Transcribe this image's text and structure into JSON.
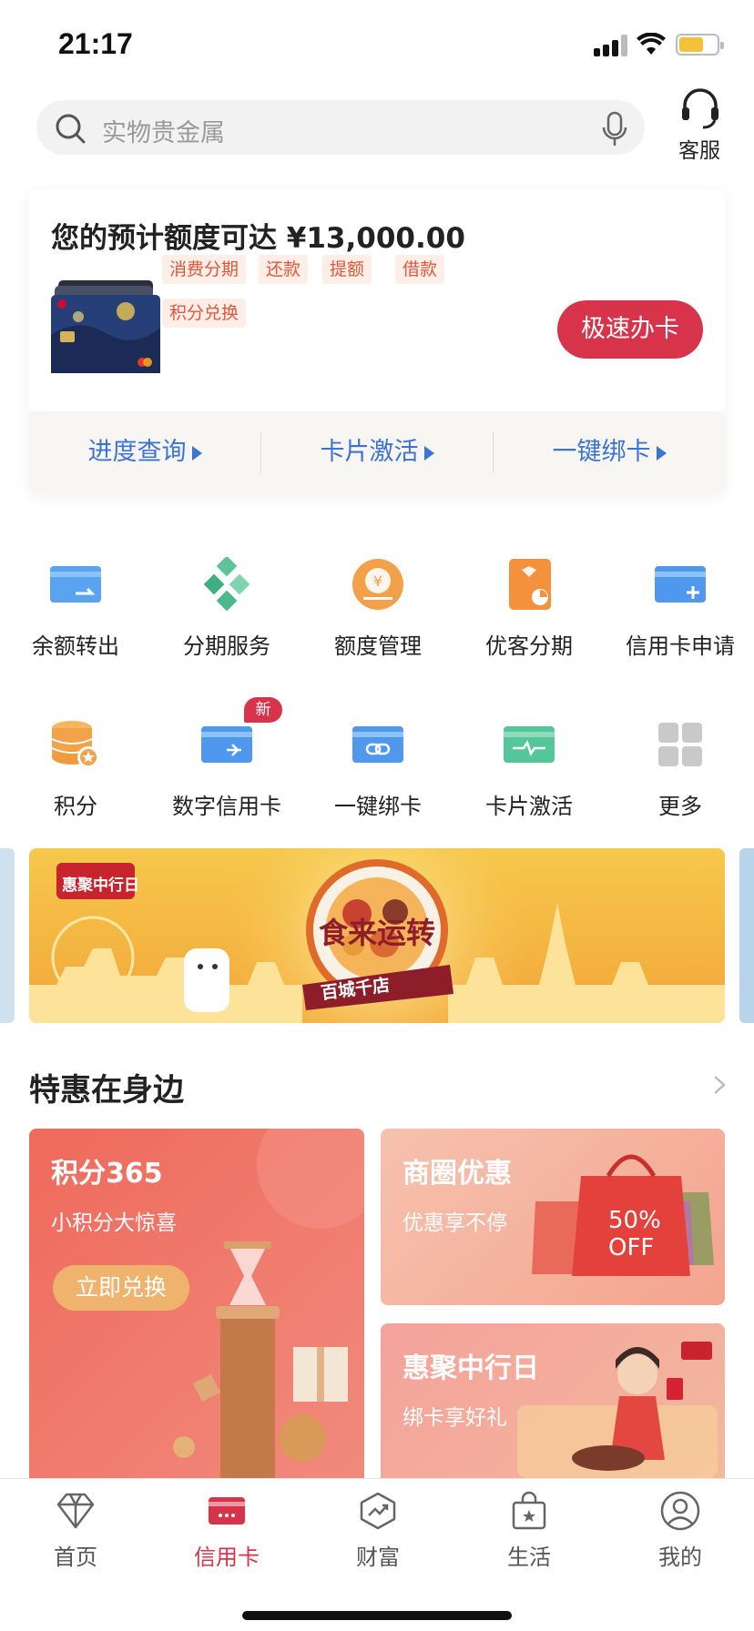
{
  "status_bar": {
    "time": "21:17"
  },
  "search": {
    "placeholder": "实物贵金属"
  },
  "header": {
    "service_label": "客服"
  },
  "credit_card_panel": {
    "title": "您的预计额度可达 ¥13,000.00",
    "tags": [
      "消费分期",
      "还款",
      "提额",
      "借款",
      "积分兑换"
    ],
    "apply_button": "极速办卡",
    "links": [
      "进度查询",
      "卡片激活",
      "一键绑卡"
    ]
  },
  "grid": {
    "row1": [
      {
        "label": "余额转出",
        "icon": "balance-transfer-icon"
      },
      {
        "label": "分期服务",
        "icon": "installment-service-icon"
      },
      {
        "label": "额度管理",
        "icon": "limit-management-icon"
      },
      {
        "label": "优客分期",
        "icon": "youke-installment-icon"
      },
      {
        "label": "信用卡申请",
        "icon": "card-apply-icon"
      }
    ],
    "row2": [
      {
        "label": "积分",
        "icon": "points-icon"
      },
      {
        "label": "数字信用卡",
        "icon": "digital-card-icon"
      },
      {
        "label": "一键绑卡",
        "icon": "bind-card-icon"
      },
      {
        "label": "卡片激活",
        "icon": "card-activate-icon"
      },
      {
        "label": "更多",
        "icon": "more-grid-icon"
      }
    ],
    "new_badge": "新"
  },
  "banner": {
    "logo_text": "惠聚中行日",
    "center_text": "食来运转",
    "sub_text": "百城千店"
  },
  "section": {
    "title": "特惠在身边"
  },
  "promos": {
    "points": {
      "title": "积分365",
      "subtitle": "小积分大惊喜",
      "button": "立即兑换"
    },
    "mall": {
      "title": "商圈优惠",
      "subtitle": "优惠享不停",
      "sale_text_1": "50%",
      "sale_text_2": "OFF"
    },
    "boc_day": {
      "title": "惠聚中行日",
      "subtitle": "绑卡享好礼"
    }
  },
  "tabbar": {
    "tabs": [
      {
        "label": "首页",
        "icon": "diamond-icon",
        "active": false
      },
      {
        "label": "信用卡",
        "icon": "credit-card-icon",
        "active": true
      },
      {
        "label": "财富",
        "icon": "wealth-chart-icon",
        "active": false
      },
      {
        "label": "生活",
        "icon": "shopping-bag-star-icon",
        "active": false
      },
      {
        "label": "我的",
        "icon": "profile-icon",
        "active": false
      }
    ]
  },
  "colors": {
    "accent": "#d7334a",
    "link_blue": "#3c73d6",
    "tag_text": "#e0583c"
  }
}
